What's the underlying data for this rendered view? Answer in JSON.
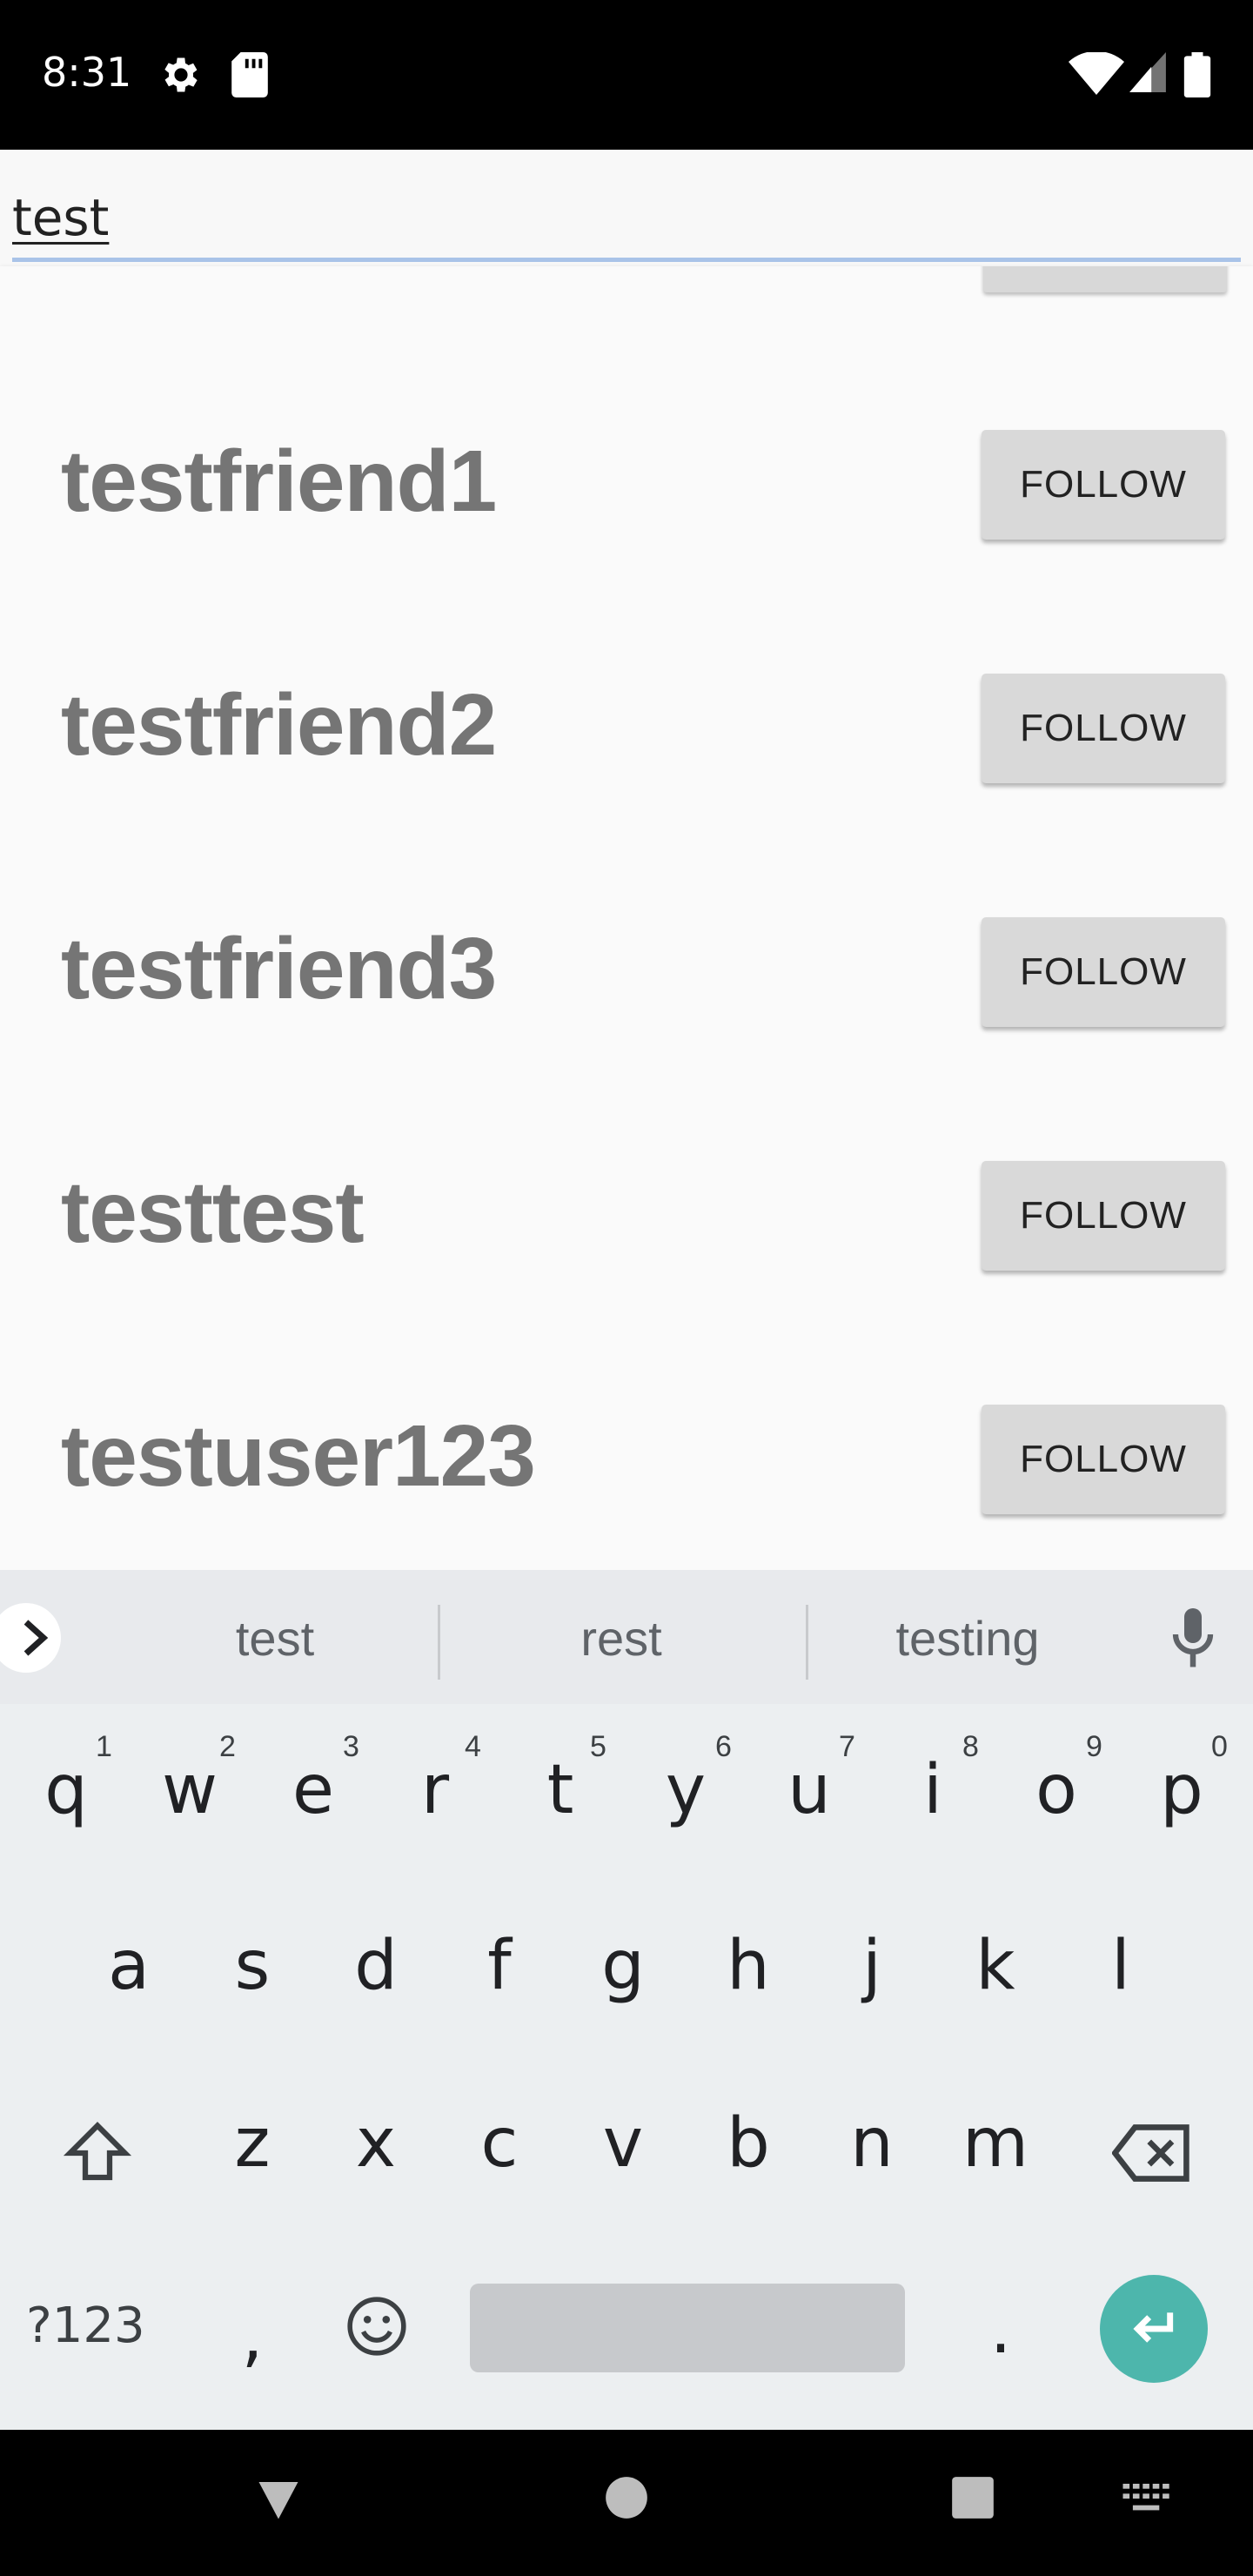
{
  "status_bar": {
    "time": "8:31",
    "icons": [
      "gear-icon",
      "sd-card-icon",
      "wifi-icon",
      "signal-icon",
      "battery-icon"
    ]
  },
  "search": {
    "value": "test"
  },
  "results": [
    {
      "name": "testfriend1",
      "button": "FOLLOW"
    },
    {
      "name": "testfriend2",
      "button": "FOLLOW"
    },
    {
      "name": "testfriend3",
      "button": "FOLLOW"
    },
    {
      "name": "testtest",
      "button": "FOLLOW"
    },
    {
      "name": "testuser123",
      "button": "FOLLOW"
    }
  ],
  "keyboard": {
    "suggestions": [
      "test",
      "rest",
      "testing"
    ],
    "row1": [
      "q",
      "w",
      "e",
      "r",
      "t",
      "y",
      "u",
      "i",
      "o",
      "p"
    ],
    "row1_hints": [
      "1",
      "2",
      "3",
      "4",
      "5",
      "6",
      "7",
      "8",
      "9",
      "0"
    ],
    "row2": [
      "a",
      "s",
      "d",
      "f",
      "g",
      "h",
      "j",
      "k",
      "l"
    ],
    "row3": [
      "z",
      "x",
      "c",
      "v",
      "b",
      "n",
      "m"
    ],
    "symbols_label": "?123",
    "comma": ",",
    "period": "."
  },
  "colors": {
    "accent": "#4db6ac",
    "button_bg": "#d9d9d9",
    "name_text": "#757575"
  }
}
